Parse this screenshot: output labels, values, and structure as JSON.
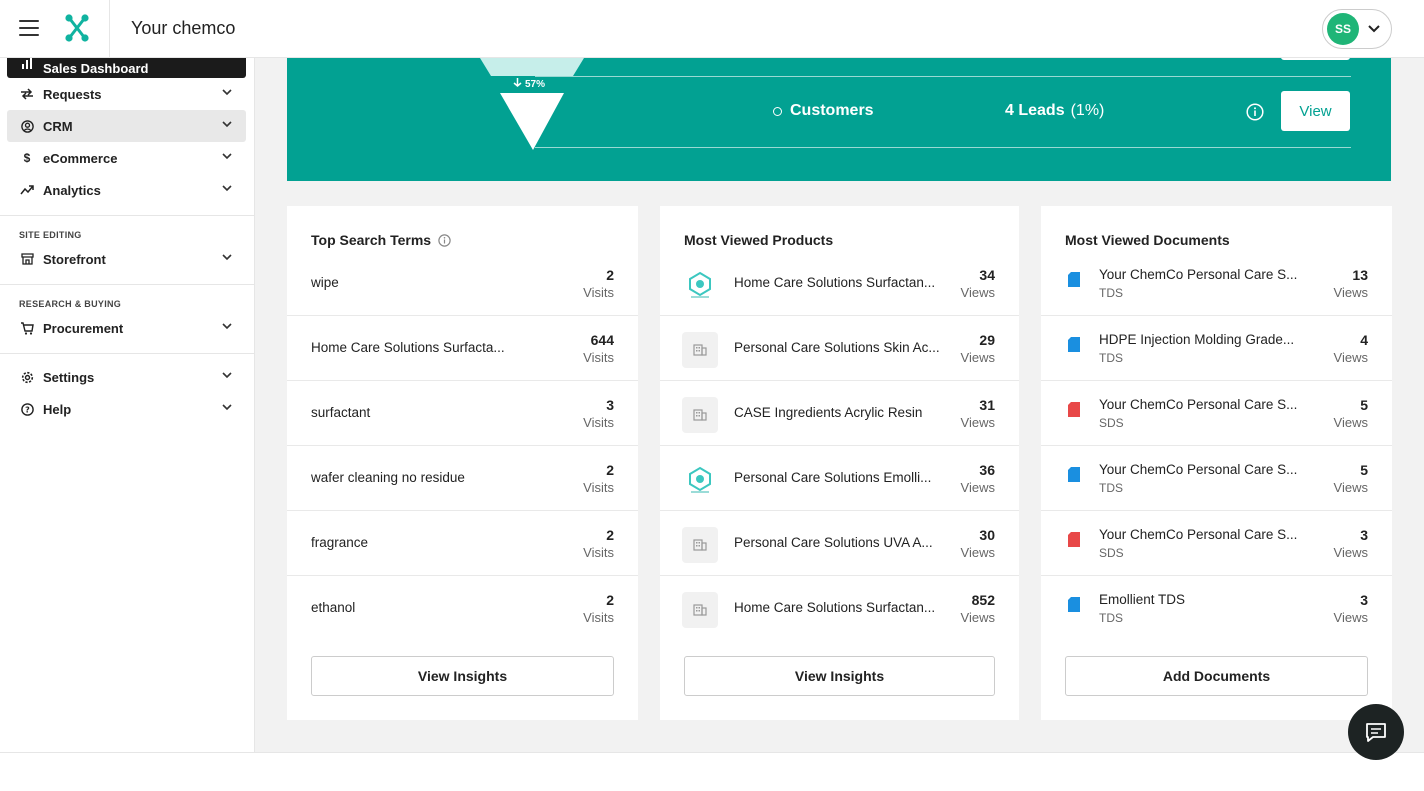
{
  "header": {
    "company": "Your chemco",
    "avatar_initials": "SS"
  },
  "sidebar": {
    "items": [
      {
        "label": "Sales Dashboard",
        "icon": "bar-chart-icon"
      },
      {
        "label": "Requests",
        "icon": "swap-icon"
      },
      {
        "label": "CRM",
        "icon": "user-circle-icon"
      },
      {
        "label": "eCommerce",
        "icon": "dollar-icon"
      },
      {
        "label": "Analytics",
        "icon": "trend-icon"
      }
    ],
    "site_editing_label": "SITE EDITING",
    "storefront": "Storefront",
    "research_label": "RESEARCH & BUYING",
    "procurement": "Procurement",
    "settings": "Settings",
    "help": "Help"
  },
  "funnel": {
    "conversion_pct": "57%",
    "stage_name": "Customers",
    "stage_leads": "4 Leads",
    "stage_share": "(1%)",
    "view_label": "View",
    "accent": "#02a192"
  },
  "top_search": {
    "title": "Top Search Terms",
    "unit": "Visits",
    "rows": [
      {
        "term": "wipe",
        "count": "2"
      },
      {
        "term": "Home Care Solutions Surfacta...",
        "count": "644"
      },
      {
        "term": "surfactant",
        "count": "3"
      },
      {
        "term": "wafer cleaning no residue",
        "count": "2"
      },
      {
        "term": "fragrance",
        "count": "2"
      },
      {
        "term": "ethanol",
        "count": "2"
      }
    ],
    "button": "View Insights"
  },
  "products": {
    "title": "Most Viewed Products",
    "unit": "Views",
    "rows": [
      {
        "name": "Home Care Solutions Surfactan...",
        "count": "34",
        "thumb": "logo"
      },
      {
        "name": "Personal Care Solutions Skin Ac...",
        "count": "29",
        "thumb": "building"
      },
      {
        "name": "CASE Ingredients Acrylic Resin",
        "count": "31",
        "thumb": "building"
      },
      {
        "name": "Personal Care Solutions Emolli...",
        "count": "36",
        "thumb": "logo"
      },
      {
        "name": "Personal Care Solutions UVA A...",
        "count": "30",
        "thumb": "building"
      },
      {
        "name": "Home Care Solutions Surfactan...",
        "count": "852",
        "thumb": "building"
      }
    ],
    "button": "View Insights"
  },
  "documents": {
    "title": "Most Viewed Documents",
    "unit": "Views",
    "rows": [
      {
        "name": "Your ChemCo Personal Care S...",
        "type": "TDS",
        "count": "13",
        "color": "#1a8fe0"
      },
      {
        "name": "HDPE Injection Molding Grade...",
        "type": "TDS",
        "count": "4",
        "color": "#1a8fe0"
      },
      {
        "name": "Your ChemCo Personal Care S...",
        "type": "SDS",
        "count": "5",
        "color": "#e84848"
      },
      {
        "name": "Your ChemCo Personal Care S...",
        "type": "TDS",
        "count": "5",
        "color": "#1a8fe0"
      },
      {
        "name": "Your ChemCo Personal Care S...",
        "type": "SDS",
        "count": "3",
        "color": "#e84848"
      },
      {
        "name": "Emollient TDS",
        "type": "TDS",
        "count": "3",
        "color": "#1a8fe0"
      }
    ],
    "button": "Add Documents"
  }
}
